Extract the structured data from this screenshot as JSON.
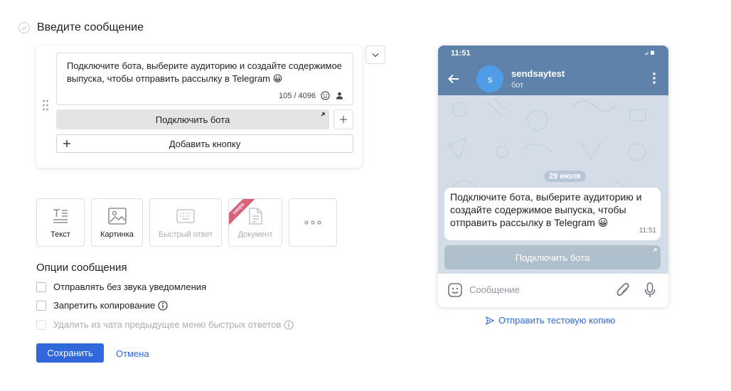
{
  "header": {
    "title": "Введите сообщение"
  },
  "editor": {
    "message_text": "Подключите бота, выберите аудиторию и создайте содержимое выпуска, чтобы отправить рассылку в Telegram 😀",
    "char_counter": "105 / 4096",
    "bot_button_label": "Подключить бота",
    "add_button_label": "Добавить кнопку"
  },
  "content_types": [
    {
      "label": "Текст",
      "icon": "text-icon",
      "disabled": false
    },
    {
      "label": "Картинка",
      "icon": "image-icon",
      "disabled": false
    },
    {
      "label": "Быстрый ответ",
      "icon": "keyboard-icon",
      "disabled": true
    },
    {
      "label": "Документ",
      "icon": "document-icon",
      "disabled": true,
      "badge": "скоро"
    },
    {
      "label": "",
      "icon": "more-icon",
      "disabled": false
    }
  ],
  "options": {
    "title": "Опции сообщения",
    "items": [
      {
        "label": "Отправлять без звука уведомления",
        "checked": false,
        "disabled": false
      },
      {
        "label": "Запретить копирование",
        "checked": false,
        "disabled": false
      },
      {
        "label": "Удалить из чата предыдущее меню быстрых ответов",
        "checked": false,
        "disabled": true
      }
    ]
  },
  "actions": {
    "save_label": "Сохранить",
    "cancel_label": "Отмена"
  },
  "preview": {
    "status_time": "11:51",
    "chat_name": "sendsaytest",
    "chat_sub": "бот",
    "avatar_letter": "s",
    "date_badge": "29 июля",
    "bubble_text": "Подключите бота, выберите аудиторию и создайте содержимое выпуска, чтобы отправить рассылку в Telegram 😀",
    "bubble_time": "11:51",
    "button_label": "Подключить бота",
    "input_placeholder": "Сообщение"
  },
  "send_test_label": "Отправить тестовую копию",
  "colors": {
    "accent": "#3068db",
    "telegram_header": "#5e82aa",
    "badge": "#d9627b"
  }
}
